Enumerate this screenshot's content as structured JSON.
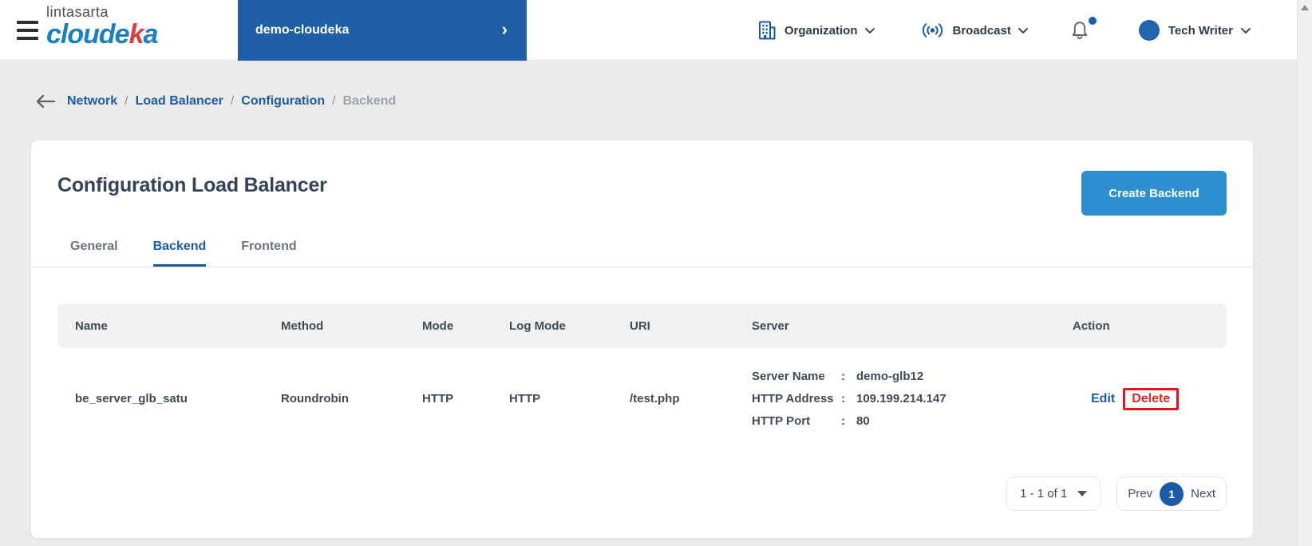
{
  "brand": {
    "logo_top": "lintasarta",
    "logo_main_1": "cloude",
    "logo_main_accent": "k",
    "logo_main_2": "a",
    "project_selector": "demo-cloudeka"
  },
  "header": {
    "organization_label": "Organization",
    "broadcast_label": "Broadcast",
    "user_name": "Tech Writer"
  },
  "icons": {
    "project_chevron": "›"
  },
  "breadcrumb": {
    "separator": "/",
    "items": [
      {
        "label": "Network"
      },
      {
        "label": "Load Balancer"
      },
      {
        "label": "Configuration"
      },
      {
        "label": "Backend"
      }
    ]
  },
  "page": {
    "title": "Configuration Load Balancer",
    "create_button_label": "Create Backend",
    "tabs": [
      {
        "label": "General",
        "active": false
      },
      {
        "label": "Backend",
        "active": true
      },
      {
        "label": "Frontend",
        "active": false
      }
    ]
  },
  "table": {
    "columns": [
      "Name",
      "Method",
      "Mode",
      "Log Mode",
      "URI",
      "Server",
      "Action"
    ],
    "colon": ":",
    "rows": [
      {
        "name": "be_server_glb_satu",
        "method": "Roundrobin",
        "mode": "HTTP",
        "log_mode": "HTTP",
        "uri": "/test.php",
        "server": [
          {
            "label": "Server Name",
            "value": "demo-glb12"
          },
          {
            "label": "HTTP Address",
            "value": "109.199.214.147"
          },
          {
            "label": "HTTP Port",
            "value": "80"
          }
        ],
        "actions": {
          "edit": "Edit",
          "delete": "Delete"
        }
      }
    ]
  },
  "pagination": {
    "range_label": "1 - 1 of 1",
    "prev_label": "Prev",
    "current_page": "1",
    "next_label": "Next"
  },
  "colors": {
    "brand_blue": "#1b5ca8",
    "panel_blue": "#1e5fa6",
    "button_blue": "#2e8fd0",
    "logo_blue": "#1b7fc4",
    "logo_red": "#e23b3c",
    "delete_red": "#da2b27",
    "highlight_red": "#e0161f",
    "page_background": "#ebebec"
  }
}
